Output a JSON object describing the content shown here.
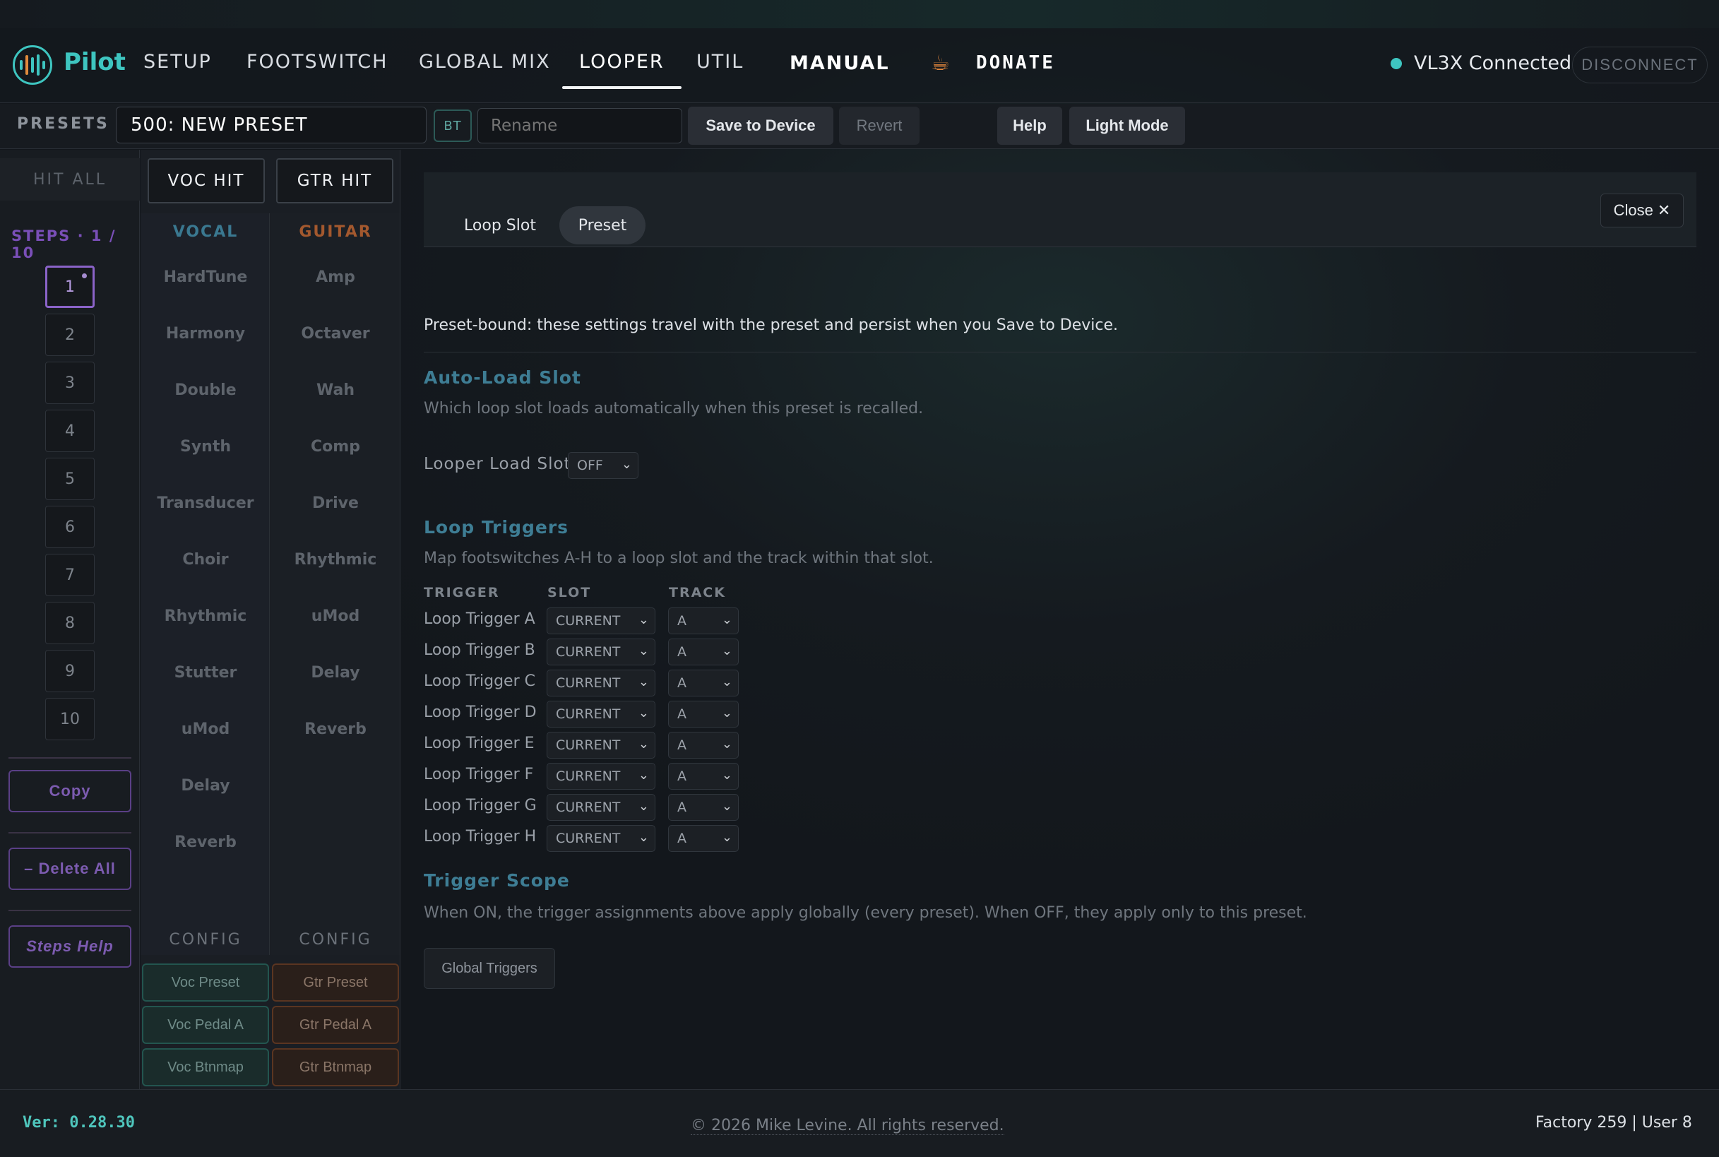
{
  "nav": {
    "brand": "Pilot",
    "tabs": [
      {
        "label": "SETUP"
      },
      {
        "label": "FOOTSWITCH"
      },
      {
        "label": "GLOBAL MIX"
      },
      {
        "label": "LOOPER"
      },
      {
        "label": "UTIL"
      }
    ],
    "manual": "MANUAL",
    "donate": "DONATE",
    "status": "VL3X Connected",
    "disconnect": "DISCONNECT",
    "accent": "#3ec5c0"
  },
  "presetbar": {
    "label": "PRESETS",
    "name": "500: NEW PRESET",
    "bt": "BT",
    "rename_placeholder": "Rename",
    "save": "Save to Device",
    "revert": "Revert",
    "help": "Help",
    "lightmode": "Light Mode"
  },
  "steps": {
    "hitall": "HIT ALL",
    "label": "STEPS · 1 / 10",
    "items": [
      "1",
      "2",
      "3",
      "4",
      "5",
      "6",
      "7",
      "8",
      "9",
      "10"
    ],
    "copy": "Copy",
    "delete_all": "– Delete All",
    "help": "Steps Help"
  },
  "fx": {
    "voc_hit": "VOC HIT",
    "gtr_hit": "GTR HIT",
    "vocal_head": "VOCAL",
    "guitar_head": "GUITAR",
    "vocal": [
      "HardTune",
      "Harmony",
      "Double",
      "Synth",
      "Transducer",
      "Choir",
      "Rhythmic",
      "Stutter",
      "uMod",
      "Delay",
      "Reverb"
    ],
    "guitar": [
      "Amp",
      "Octaver",
      "Wah",
      "Comp",
      "Drive",
      "Rhythmic",
      "uMod",
      "Delay",
      "Reverb"
    ],
    "config": "CONFIG",
    "voc_buttons": [
      "Voc Preset",
      "Voc Pedal A",
      "Voc Btnmap"
    ],
    "gtr_buttons": [
      "Gtr Preset",
      "Gtr Pedal A",
      "Gtr Btnmap"
    ]
  },
  "panel": {
    "tabs": [
      "Loop Slot",
      "Preset"
    ],
    "close": "Close",
    "note": "Preset-bound: these settings travel with the preset and persist when you Save to Device.",
    "autoload": {
      "title": "Auto-Load Slot",
      "desc": "Which loop slot loads automatically when this preset is recalled.",
      "field_label": "Looper Load Slot",
      "value": "OFF"
    },
    "triggers": {
      "title": "Loop Triggers",
      "desc": "Map footswitches A-H to a loop slot and the track within that slot.",
      "headers": [
        "TRIGGER",
        "SLOT",
        "TRACK"
      ],
      "rows": [
        {
          "label": "Loop Trigger A",
          "slot": "CURRENT",
          "track": "A"
        },
        {
          "label": "Loop Trigger B",
          "slot": "CURRENT",
          "track": "A"
        },
        {
          "label": "Loop Trigger C",
          "slot": "CURRENT",
          "track": "A"
        },
        {
          "label": "Loop Trigger D",
          "slot": "CURRENT",
          "track": "A"
        },
        {
          "label": "Loop Trigger E",
          "slot": "CURRENT",
          "track": "A"
        },
        {
          "label": "Loop Trigger F",
          "slot": "CURRENT",
          "track": "A"
        },
        {
          "label": "Loop Trigger G",
          "slot": "CURRENT",
          "track": "A"
        },
        {
          "label": "Loop Trigger H",
          "slot": "CURRENT",
          "track": "A"
        }
      ]
    },
    "scope": {
      "title": "Trigger Scope",
      "desc": "When ON, the trigger assignments above apply globally (every preset). When OFF, they apply only to this preset.",
      "button": "Global Triggers"
    }
  },
  "footer": {
    "version": "Ver: 0.28.30",
    "copyright": "© 2026 Mike Levine. All rights reserved.",
    "counts": "Factory 259 | User 8"
  }
}
